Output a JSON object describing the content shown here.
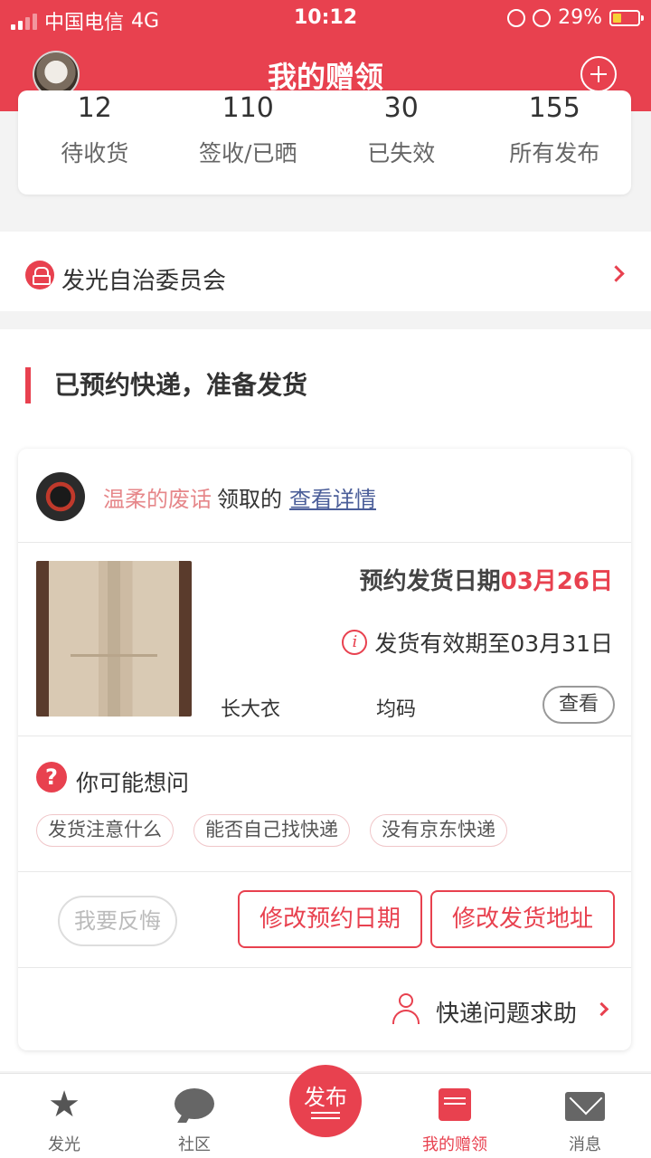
{
  "status_bar": {
    "carrier": "中国电信",
    "network": "4G",
    "time": "10:12",
    "battery": "29%"
  },
  "header": {
    "title": "我的赠领"
  },
  "stats": [
    {
      "count": "12",
      "label": "待收货"
    },
    {
      "count": "110",
      "label": "签收/已晒"
    },
    {
      "count": "30",
      "label": "已失效"
    },
    {
      "count": "155",
      "label": "所有发布"
    }
  ],
  "committee": {
    "label": "发光自治委员会"
  },
  "section": {
    "title": "已预约快递，准备发货"
  },
  "order": {
    "user_name": "温柔的废话",
    "claim_text": "领取的",
    "detail_link": "查看详情",
    "ship_date_label": "预约发货日期",
    "ship_date_value": "03月26日",
    "valid_text": "发货有效期至03月31日",
    "product_name": "长大衣",
    "product_size": "均码",
    "view_label": "查看",
    "faq_title": "你可能想问",
    "faq_tags": [
      "发货注意什么",
      "能否自己找快递",
      "没有京东快递"
    ],
    "regret_label": "我要反悔",
    "modify_date_label": "修改预约日期",
    "modify_address_label": "修改发货地址",
    "help_label": "快递问题求助"
  },
  "tabbar": {
    "items": [
      {
        "label": "发光",
        "icon": "star-icon"
      },
      {
        "label": "社区",
        "icon": "chat-bubble-icon"
      },
      {
        "label": "我的赠领",
        "icon": "gift-book-icon",
        "active": true
      },
      {
        "label": "消息",
        "icon": "mail-icon"
      }
    ],
    "publish_label": "发布"
  },
  "colors": {
    "accent": "#e8414f",
    "link": "#4b5e99",
    "username": "#e6878a"
  }
}
